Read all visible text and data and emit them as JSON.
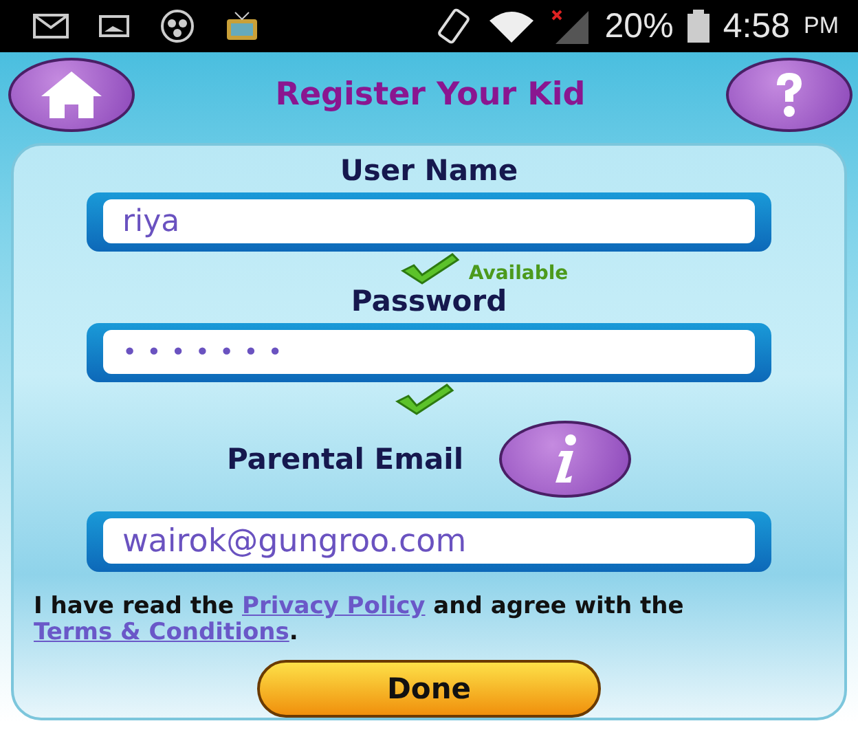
{
  "status_bar": {
    "battery": "20%",
    "time": "4:58",
    "meridiem": "PM"
  },
  "header": {
    "title": "Register Your Kid"
  },
  "fields": [
    {
      "kind": "text",
      "label": "User Name",
      "value": "riya",
      "valid": true,
      "status": "Available"
    },
    {
      "kind": "password",
      "label": "Password",
      "value": "•••••••",
      "valid": true
    },
    {
      "kind": "email",
      "label": "Parental Email",
      "value": "wairok@gungroo.com",
      "info": true
    }
  ],
  "agreement": [
    {
      "kind": "text",
      "text": "I have read the "
    },
    {
      "kind": "link",
      "text": "Privacy Policy"
    },
    {
      "kind": "text",
      "text": " and agree with the "
    },
    {
      "kind": "link",
      "text": "Terms & Conditions"
    },
    {
      "kind": "text",
      "text": "."
    }
  ],
  "done_button": "Done"
}
